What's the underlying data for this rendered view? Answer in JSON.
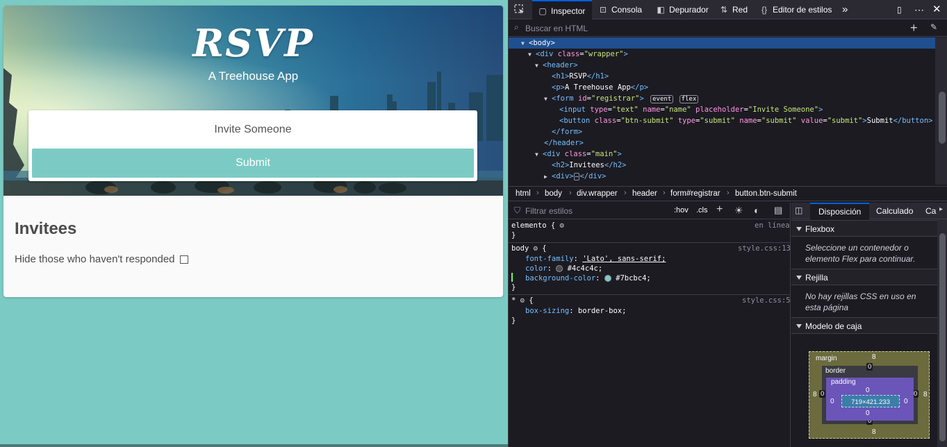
{
  "app": {
    "title": "RSVP",
    "subtitle": "A Treehouse App",
    "form": {
      "input_placeholder": "Invite Someone",
      "submit_label": "Submit"
    },
    "invitees_heading": "Invitees",
    "hide_label": "Hide those who haven't responded",
    "hide_checked": false,
    "colors": {
      "background": "#7bcbc4",
      "text": "#4c4c4c"
    }
  },
  "devtools": {
    "tabs": [
      {
        "label": "Inspector",
        "icon": "inspector-icon",
        "active": true
      },
      {
        "label": "Consola",
        "icon": "console-icon"
      },
      {
        "label": "Depurador",
        "icon": "debugger-icon"
      },
      {
        "label": "Red",
        "icon": "network-icon"
      },
      {
        "label": "Editor de estilos",
        "icon": "style-editor-icon"
      }
    ],
    "search_placeholder": "Buscar en HTML",
    "tree": {
      "body": "<body>",
      "l1": {
        "tag": "div",
        "attr": "class",
        "val": "\"wrapper\""
      },
      "l2": "<header>",
      "l3": {
        "open": "<h1>",
        "text": "RSVP",
        "close": "</h1>"
      },
      "l4": {
        "open": "<p>",
        "text": "A Treehouse App",
        "close": "</p>"
      },
      "l5": {
        "tag": "form",
        "attr": "id",
        "val": "\"registrar\"",
        "badge1": "event",
        "badge2": "flex"
      },
      "l6": {
        "tag": "input",
        "a1": "type",
        "v1": "\"text\"",
        "a2": "name",
        "v2": "\"name\"",
        "a3": "placeholder",
        "v3": "\"Invite Someone\""
      },
      "l7": {
        "tag": "button",
        "a1": "class",
        "v1": "\"btn-submit\"",
        "a2": "type",
        "v2": "\"submit\"",
        "a3": "name",
        "v3": "\"submit\"",
        "a4": "value",
        "v4": "\"submit\"",
        "text": "Submit",
        "close": "</button>"
      },
      "l8": "</form>",
      "l9": "</header>",
      "l10": {
        "tag": "div",
        "attr": "class",
        "val": "\"main\""
      },
      "l11": {
        "open": "<h2>",
        "text": "Invitees",
        "close": "</h2>"
      },
      "l12": {
        "open": "<div>",
        "close": "</div>"
      }
    },
    "breadcrumbs": [
      "html",
      "body",
      "div.wrapper",
      "header",
      "form#registrar",
      "button.btn-submit"
    ],
    "rules": {
      "filter_placeholder": "Filtrar estilos",
      "hov": ":hov",
      "cls": ".cls",
      "element_selector": "elemento {",
      "element_source": "en línea",
      "body_selector": "body",
      "body_source": "style.css:13",
      "body_props": [
        {
          "name": "font-family",
          "value": "'Lato', sans-serif;"
        },
        {
          "name": "color",
          "value": "#4c4c4c;",
          "swatch": "#4c4c4c"
        },
        {
          "name": "background-color",
          "value": "#7bcbc4;",
          "swatch": "#7bcbc4"
        }
      ],
      "star_selector": "*",
      "star_source": "style.css:5",
      "star_props": [
        {
          "name": "box-sizing",
          "value": "border-box;"
        }
      ]
    },
    "layout": {
      "tabs": [
        "Disposición",
        "Calculado",
        "Ca"
      ],
      "flexbox_title": "Flexbox",
      "flexbox_note": "Seleccione un contenedor o elemento Flex para continuar.",
      "grid_title": "Rejilla",
      "grid_note": "No hay rejillas CSS en uso en esta página",
      "boxmodel_title": "Modelo de caja",
      "boxmodel": {
        "margin_label": "margin",
        "border_label": "border",
        "padding_label": "padding",
        "margin": {
          "top": "8",
          "right": "8",
          "bottom": "8",
          "left": "8"
        },
        "border": {
          "top": "0",
          "right": "0",
          "bottom": "0",
          "left": "0"
        },
        "padding": {
          "top": "0",
          "right": "0",
          "bottom": "0",
          "left": "0"
        },
        "content": "719×421.233"
      }
    }
  }
}
